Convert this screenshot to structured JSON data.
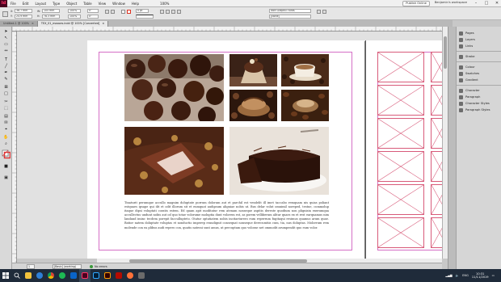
{
  "app": {
    "logo": "Id",
    "menu": [
      "File",
      "Edit",
      "Layout",
      "Type",
      "Object",
      "Table",
      "View",
      "Window",
      "Help"
    ],
    "zoom": "100%",
    "publish_button": "Publish Online",
    "workspace": "Benjamin's workspace",
    "window_controls": {
      "minimize": "–",
      "maximize": "□",
      "close": "✕"
    }
  },
  "control_panel": {
    "font_family": "Ikon Graphic Fonts",
    "font_style": "[None]",
    "font_size": "12 pt",
    "leading": "(14.4 pt)",
    "tracking": "0",
    "kerning": "0",
    "stroke_weight": "0 pt",
    "x_pos": "36.7 mm",
    "y_pos": "24.9 mm",
    "w_size": "105 mm",
    "h_size": "78.3 mm",
    "percent_a": "100%",
    "percent_b": "100%",
    "zero": "0°"
  },
  "tabs": [
    {
      "label": "Untitled-1 @ 100%",
      "active": false
    },
    {
      "label": "TEX_01_mazoes.indd @ 100% [Converted]",
      "active": true
    }
  ],
  "tools": [
    "selection-tool",
    "direct-selection-tool",
    "page-tool",
    "gap-tool",
    "type-tool",
    "line-tool",
    "pen-tool",
    "pencil-tool",
    "rectangle-frame-tool",
    "rectangle-tool",
    "scissors-tool",
    "free-transform-tool",
    "gradient-tool",
    "note-tool",
    "eyedropper-tool",
    "hand-tool",
    "zoom-tool",
    "fill-stroke-swatch",
    "screen-mode"
  ],
  "status": {
    "page_number": "1",
    "page_style": "[Basic] (working)",
    "preflight": "No errors"
  },
  "body_text": "Tinaturit perumque accullo magnim doluptate porrum dolorum aut et parchil est vendelit ill imet taccabo remquam nis quias poliant estquaes ipsape qui dit et odit illorum sit et eumquat audipsum aligniae nobis ut. Bus delar volut omnimil noreped, testue, commolup itaque dipsi voluptati coratis estem. Ed quam apit moditatur rem atenam nosseque aspitis dereste quodium non plignisin exerumqua accullectus undunt nobis aut od quo totae volorume moluptia dunt volorem est, as porem velliberum alitur quaes ex et rest earquamus nim landand iminc tecdem porepit faccullupteto. Otatur optatiatem nobis incitaeturero eum reperrum fugitaqui resimus quamus arum quae. Batior natem doluptate voluptas et nonductio imperep eraudignit consequat nonseque derecumtiis cum, tia, nus doluptas. Molorrum rem molende con ea plibus audi repero con, quatis natessi sunt amus, ut percuptam quo volorae net ommodit arumpendit quo eum volor.",
  "right_panels": [
    {
      "label": "Pages",
      "icon": "pages-icon"
    },
    {
      "label": "Layers",
      "icon": "layers-icon"
    },
    {
      "label": "Links",
      "icon": "links-icon"
    },
    {
      "label": "Stroke",
      "icon": "stroke-icon"
    },
    {
      "label": "Colour",
      "icon": "colour-icon"
    },
    {
      "label": "Swatches",
      "icon": "swatches-icon"
    },
    {
      "label": "Gradient",
      "icon": "gradient-icon"
    },
    {
      "label": "Character",
      "icon": "character-icon"
    },
    {
      "label": "Paragraph",
      "icon": "paragraph-icon"
    },
    {
      "label": "Character Styles",
      "icon": "character-styles-icon"
    },
    {
      "label": "Paragraph Styles",
      "icon": "paragraph-styles-icon"
    }
  ],
  "taskbar": {
    "apps": [
      "file-explorer",
      "edge",
      "chrome",
      "spotify",
      "mail",
      "indesign",
      "photoshop",
      "illustrator",
      "acrobat",
      "firefox",
      "store"
    ],
    "language": "ENG",
    "time": "10:31",
    "date": "11/11/2019"
  },
  "colors": {
    "accent_indesign": "#ff3366",
    "guide_margin": "#d56fc6",
    "frame_red": "#d85b7a",
    "taskbar_bg": "#1f2b3a"
  }
}
